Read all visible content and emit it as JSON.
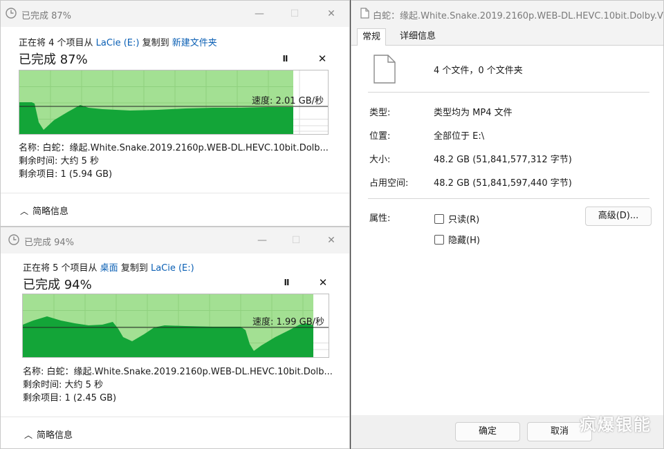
{
  "copy1": {
    "title": "已完成 87%",
    "line_prefix": "正在将 4 个项目从 ",
    "source": "LaCie (E:)",
    "line_mid": " 复制到 ",
    "dest": "新建文件夹",
    "percent_label": "已完成 87%",
    "progress": 0.87,
    "speed": "速度: 2.01 GB/秒",
    "name_line": "名称: 白蛇：缘起.White.Snake.2019.2160p.WEB-DL.HEVC.10bit.Dolb...",
    "time_line": "剩余时间: 大约 5 秒",
    "items_line": "剩余项目: 1 (5.94 GB)",
    "summary": "简略信息",
    "pause_glyph": "II",
    "close_glyph": "✕"
  },
  "copy2": {
    "title": "已完成 94%",
    "line_prefix": "正在将 5 个项目从 ",
    "source": "桌面",
    "line_mid": " 复制到 ",
    "dest": "LaCie (E:)",
    "percent_label": "已完成 94%",
    "progress": 0.94,
    "speed": "速度: 1.99 GB/秒",
    "name_line": "名称: 白蛇：缘起.White.Snake.2019.2160p.WEB-DL.HEVC.10bit.Dolb...",
    "time_line": "剩余时间: 大约 5 秒",
    "items_line": "剩余项目: 1 (2.45 GB)",
    "summary": "简略信息",
    "pause_glyph": "II",
    "close_glyph": "✕"
  },
  "props": {
    "title": "白蛇：缘起.White.Snake.2019.2160p.WEB-DL.HEVC.10bit.Dolby.Vi...",
    "tabs": [
      "常规",
      "详细信息"
    ],
    "file_count": "4 个文件，0 个文件夹",
    "type_label": "类型:",
    "type_value": "类型均为 MP4 文件",
    "location_label": "位置:",
    "location_value": "全部位于 E:\\",
    "size_label": "大小:",
    "size_value": "48.2 GB (51,841,577,312 字节)",
    "disk_label": "占用空间:",
    "disk_value": "48.2 GB (51,841,597,440 字节)",
    "attr_label": "属性:",
    "readonly": "只读(R)",
    "hidden": "隐藏(H)",
    "advanced": "高级(D)...",
    "ok": "确定",
    "cancel": "取消"
  },
  "watermark": "疯爆银能",
  "colors": {
    "graph_fill": "#13a538",
    "graph_bg": "#a3e093",
    "link": "#0a5fb4"
  }
}
